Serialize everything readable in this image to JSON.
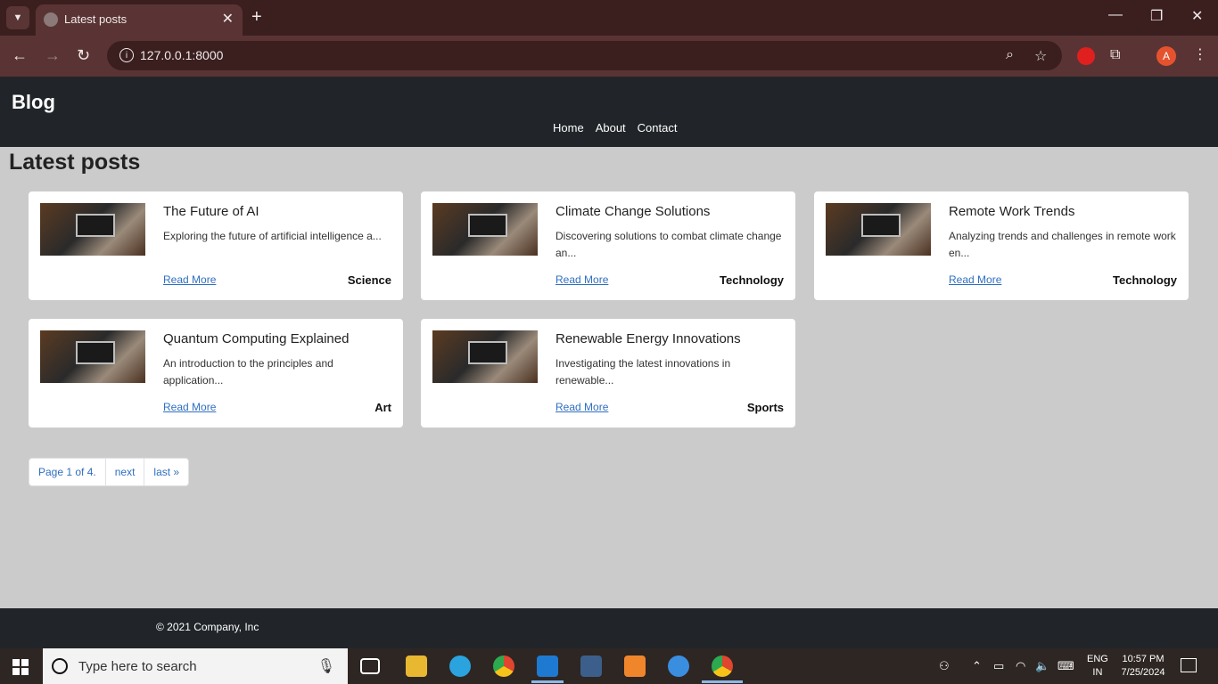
{
  "browser": {
    "tab_title": "Latest posts",
    "url": "127.0.0.1:8000",
    "profile_initial": "A",
    "window_controls": {
      "minimize": "—",
      "restore": "❐",
      "close": "✕"
    }
  },
  "site": {
    "brand": "Blog",
    "nav": [
      "Home",
      "About",
      "Contact"
    ],
    "heading": "Latest posts",
    "posts": [
      {
        "title": "The Future of AI",
        "excerpt": "Exploring the future of artificial intelligence a...",
        "link": "Read More",
        "category": "Science"
      },
      {
        "title": "Climate Change Solutions",
        "excerpt": "Discovering solutions to combat climate change an...",
        "link": "Read More",
        "category": "Technology"
      },
      {
        "title": "Remote Work Trends",
        "excerpt": "Analyzing trends and challenges in remote work en...",
        "link": "Read More",
        "category": "Technology"
      },
      {
        "title": "Quantum Computing Explained",
        "excerpt": "An introduction to the principles and application...",
        "link": "Read More",
        "category": "Art"
      },
      {
        "title": "Renewable Energy Innovations",
        "excerpt": "Investigating the latest innovations in renewable...",
        "link": "Read More",
        "category": "Sports"
      }
    ],
    "pagination": {
      "page_info": "Page 1 of 4.",
      "next": "next",
      "last": "last »"
    },
    "footer": "© 2021 Company, Inc"
  },
  "taskbar": {
    "search_placeholder": "Type here to search",
    "lang_line1": "ENG",
    "lang_line2": "IN",
    "time": "10:57 PM",
    "date": "7/25/2024"
  }
}
